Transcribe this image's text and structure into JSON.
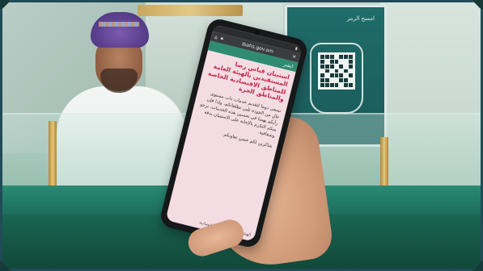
{
  "phone": {
    "url": "ibahs.gov.om",
    "status_time": "",
    "header_label": "ابشر",
    "headline": "استبيان قياس رضا المستفيدين بالهيئة العامة للمناطق الاقتصادية الخاصة والمناطق الحرة",
    "body": "نسعى دوما لتقديم خدمات ذات مستوى عالٍ من الجودة تلبي تطلعاتكم، ولذا فإن رأيكم يهمنا في تحسين هذه الخدمات، نرجو منكم التكرم بالإجابة على الاستبيان بدقة وشفافية.",
    "closing": "شاكرين لكم حسن تعاونكم",
    "footer": "الهيئة العامة للمناطق الاقتصادية"
  },
  "poster": {
    "text": "امسح الرمز"
  },
  "colors": {
    "frame_border": "#214b57",
    "counter_green": "#1c6e5c",
    "headline_red": "#c4234a",
    "screen_pink": "#f3dde3"
  },
  "icons": [
    "lock-icon",
    "share-icon",
    "close-icon",
    "qr-code-icon"
  ]
}
